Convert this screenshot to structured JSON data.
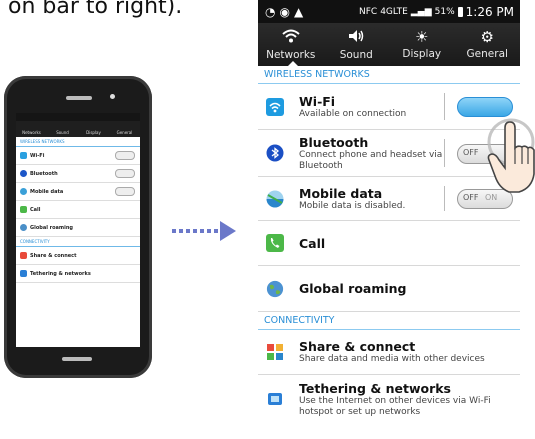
{
  "intro": {
    "text": "on bar to right)."
  },
  "mini_phone": {
    "tabs": [
      "Networks",
      "Sound",
      "Display",
      "General"
    ],
    "wireless_header": "WIRELESS NETWORKS",
    "rows": [
      "Wi-Fi",
      "Bluetooth",
      "Mobile data",
      "Call",
      "Global roaming"
    ],
    "connectivity_header": "CONNECTIVITY",
    "rows2": [
      "Share & connect",
      "Tethering & networks"
    ]
  },
  "status_bar": {
    "left_icons": [
      "sync-icon",
      "alert-icon"
    ],
    "nfc": "NFC",
    "lte": "4GLTE",
    "battery_percent": "51%",
    "time": "1:26 PM"
  },
  "tabs": [
    {
      "icon": "wifi-icon",
      "glyph": "ᯤ",
      "label": "Networks",
      "active": true
    },
    {
      "icon": "speaker-icon",
      "glyph": "🔊",
      "label": "Sound",
      "active": false
    },
    {
      "icon": "brightness-icon",
      "glyph": "☀",
      "label": "Display",
      "active": false
    },
    {
      "icon": "gear-icon",
      "glyph": "⚙",
      "label": "General",
      "active": false
    }
  ],
  "wireless_header": "WIRELESS NETWORKS",
  "wifi": {
    "title": "Wi-Fi",
    "subtitle": "Available on connection",
    "toggle_state": "on"
  },
  "bluetooth": {
    "title": "Bluetooth",
    "subtitle_line1": "Connect phone and headset via",
    "subtitle_line2": "Bluetooth",
    "toggle_label": "OFF"
  },
  "mobile_data": {
    "title": "Mobile data",
    "subtitle": "Mobile data is disabled.",
    "toggle_label": "OFF",
    "toggle_label2": "ON"
  },
  "call": {
    "title": "Call"
  },
  "global_roaming": {
    "title": "Global roaming"
  },
  "connectivity_header": "CONNECTIVITY",
  "share_connect": {
    "title": "Share & connect",
    "subtitle": "Share data and media with other devices"
  },
  "tethering": {
    "title": "Tethering & networks",
    "subtitle_line1": "Use the Internet on other devices via Wi-Fi",
    "subtitle_line2": "hotspot or set up networks"
  },
  "colors": {
    "accent": "#2a8fd6",
    "call_green": "#4cb848",
    "toggle_on": "#3ba7e6"
  }
}
